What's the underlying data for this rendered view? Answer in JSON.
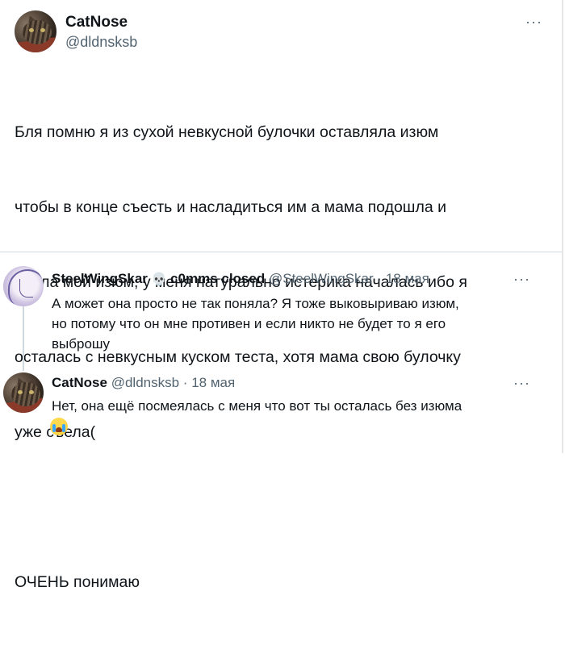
{
  "main_tweet": {
    "author_name": "CatNose",
    "author_handle": "@dldnsksb",
    "menu_icon": "more-dots-icon",
    "text_lines": [
      "Бля помню я из сухой невкусной булочки оставляла изюм",
      "чтобы в конце съесть и насладиться им а мама подошла и",
      "съела мой изюм, у меня натурально истерика началась ибо я",
      "осталась с невкусным куском теста, хотя мама свою булочку",
      "уже съела(",
      "",
      "ОЧЕНЬ понимаю"
    ]
  },
  "replies": [
    {
      "author_name": "SteelWingSkar",
      "name_emoji": "💀",
      "name_suffix": "c0mms closed",
      "author_handle": "@SteelWingSkar",
      "separator": "·",
      "date": "18 мая",
      "text_lines": [
        "А может она просто не так поняла? Я тоже выковыриваю изюм,",
        "но потому что он мне противен и если никто не будет то я его",
        "выброшу"
      ]
    },
    {
      "author_name": "CatNose",
      "author_handle": "@dldnsksb",
      "separator": "·",
      "date": "18 мая",
      "text_lines": [
        "Нет, она ещё посмеялась с меня что вот ты осталась без изюма"
      ],
      "trailing_emoji": "loudly-crying-face-icon"
    }
  ],
  "more_label": "···"
}
